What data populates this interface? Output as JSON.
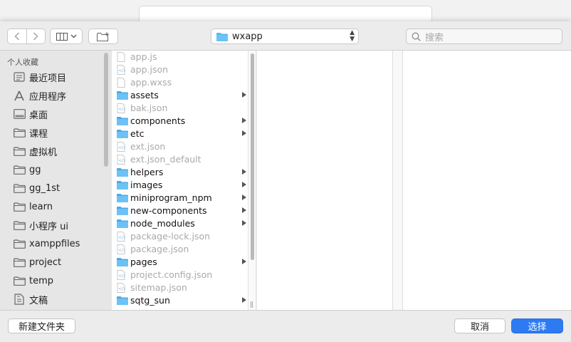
{
  "toolbar": {
    "location": "wxapp",
    "search_placeholder": "搜索"
  },
  "sidebar": {
    "header": "个人收藏",
    "items": [
      {
        "label": "最近项目",
        "icon": "recents-icon"
      },
      {
        "label": "应用程序",
        "icon": "applications-icon"
      },
      {
        "label": "桌面",
        "icon": "desktop-icon"
      },
      {
        "label": "课程",
        "icon": "folder-icon"
      },
      {
        "label": "虚拟机",
        "icon": "folder-icon"
      },
      {
        "label": "gg",
        "icon": "folder-icon"
      },
      {
        "label": "gg_1st",
        "icon": "folder-icon"
      },
      {
        "label": "learn",
        "icon": "folder-icon"
      },
      {
        "label": "小程序 ui",
        "icon": "folder-icon"
      },
      {
        "label": "xamppfiles",
        "icon": "folder-icon"
      },
      {
        "label": "project",
        "icon": "folder-icon"
      },
      {
        "label": "temp",
        "icon": "folder-icon"
      },
      {
        "label": "文稿",
        "icon": "documents-icon"
      }
    ]
  },
  "files": [
    {
      "name": "app.js",
      "type": "file",
      "enabled": false
    },
    {
      "name": "app.json",
      "type": "json",
      "enabled": false
    },
    {
      "name": "app.wxss",
      "type": "file",
      "enabled": false
    },
    {
      "name": "assets",
      "type": "folder",
      "enabled": true
    },
    {
      "name": "bak.json",
      "type": "json",
      "enabled": false
    },
    {
      "name": "components",
      "type": "folder",
      "enabled": true
    },
    {
      "name": "etc",
      "type": "folder",
      "enabled": true
    },
    {
      "name": "ext.json",
      "type": "json",
      "enabled": false
    },
    {
      "name": "ext.json_default",
      "type": "json",
      "enabled": false
    },
    {
      "name": "helpers",
      "type": "folder",
      "enabled": true
    },
    {
      "name": "images",
      "type": "folder",
      "enabled": true
    },
    {
      "name": "miniprogram_npm",
      "type": "folder",
      "enabled": true
    },
    {
      "name": "new-components",
      "type": "folder",
      "enabled": true
    },
    {
      "name": "node_modules",
      "type": "folder",
      "enabled": true
    },
    {
      "name": "package-lock.json",
      "type": "json",
      "enabled": false
    },
    {
      "name": "package.json",
      "type": "json",
      "enabled": false
    },
    {
      "name": "pages",
      "type": "folder",
      "enabled": true
    },
    {
      "name": "project.config.json",
      "type": "json",
      "enabled": false
    },
    {
      "name": "sitemap.json",
      "type": "json",
      "enabled": false
    },
    {
      "name": "sqtg_sun",
      "type": "folder",
      "enabled": true
    }
  ],
  "bottom": {
    "new_folder": "新建文件夹",
    "cancel": "取消",
    "choose": "选择"
  },
  "colors": {
    "accent": "#2c7bf2",
    "folder": "#5ab7f0"
  }
}
